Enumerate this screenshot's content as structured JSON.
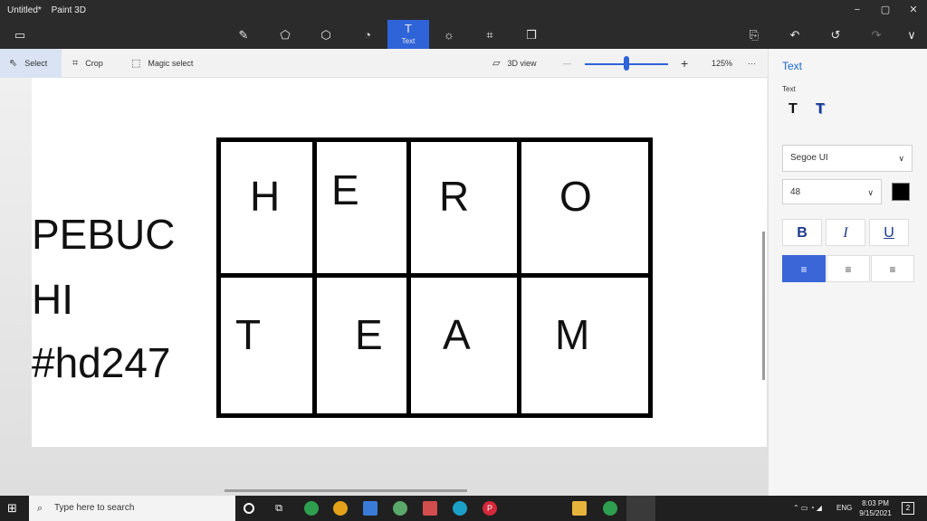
{
  "window": {
    "doc_title": "Untitled*",
    "app_name": "Paint 3D"
  },
  "window_controls": {
    "minimize": "−",
    "maximize": "▢",
    "close": "✕"
  },
  "toolbar": {
    "menu_icon": "▭",
    "tools": [
      {
        "name": "brushes-tool",
        "icon": "✎"
      },
      {
        "name": "2d-shapes-tool",
        "icon": "⬠"
      },
      {
        "name": "3d-shapes-tool",
        "icon": "⬡"
      },
      {
        "name": "stickers-tool",
        "icon": "◔"
      },
      {
        "name": "text-tool",
        "icon": "T",
        "label": "Text"
      },
      {
        "name": "effects-tool",
        "icon": "☼"
      },
      {
        "name": "canvas-tool",
        "icon": "⌗"
      },
      {
        "name": "3d-library-tool",
        "icon": "❒"
      }
    ],
    "right": {
      "paste": "⎘",
      "undo": "↶",
      "history": "↺",
      "redo": "↷",
      "expand": "∨"
    }
  },
  "subbar": {
    "select": "Select",
    "crop": "Crop",
    "magic_select": "Magic select",
    "view_3d": "3D view",
    "zoom_minus": "—",
    "zoom_plus": "+",
    "zoom_level": "125%",
    "more": "···",
    "zoom_fraction": 0.5
  },
  "canvas": {
    "left_lines": [
      "PEBUC",
      "HI",
      "#hd247"
    ],
    "grid_letters_top": [
      "H",
      "E",
      "R",
      "O"
    ],
    "grid_letters_bottom": [
      "T",
      "E",
      "A",
      "M"
    ]
  },
  "panel": {
    "title": "Text",
    "subtitle": "Text",
    "font_family": "Segoe UI",
    "font_size": "48",
    "bold": "B",
    "italic": "I",
    "underline": "U",
    "text_color": "#000000"
  },
  "taskbar": {
    "search_placeholder": "Type here to search",
    "language": "ENG",
    "time": "8:03 PM",
    "date": "9/15/2021",
    "notifications": "2"
  },
  "colors": {
    "accent": "#2f63d8",
    "titlebar": "#2b2b2b",
    "taskbar": "#202020"
  }
}
